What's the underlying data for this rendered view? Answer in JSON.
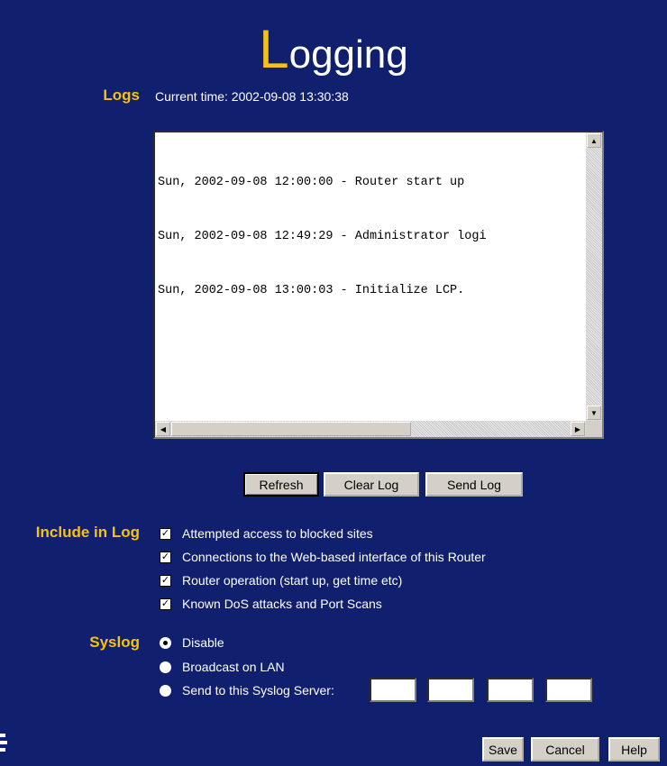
{
  "page": {
    "title_first": "L",
    "title_rest": "ogging"
  },
  "logs": {
    "label": "Logs",
    "current_time": "Current time: 2002-09-08 13:30:38",
    "entries": [
      "Sun, 2002-09-08 12:00:00 - Router start up",
      "Sun, 2002-09-08 12:49:29 - Administrator logi",
      "Sun, 2002-09-08 13:00:03 - Initialize LCP."
    ],
    "buttons": {
      "refresh": "Refresh",
      "clear": "Clear Log",
      "send": "Send Log"
    }
  },
  "include": {
    "label": "Include in Log",
    "options": [
      {
        "label": "Attempted access to blocked sites",
        "checked": true
      },
      {
        "label": "Connections to the Web-based interface of this Router",
        "checked": true
      },
      {
        "label": "Router operation (start up, get time etc)",
        "checked": true
      },
      {
        "label": "Known DoS attacks and Port Scans",
        "checked": true
      }
    ]
  },
  "syslog": {
    "label": "Syslog",
    "options": [
      {
        "label": "Disable",
        "selected": true
      },
      {
        "label": "Broadcast on LAN",
        "selected": false
      },
      {
        "label": "Send to this Syslog Server:",
        "selected": false
      }
    ],
    "ip": [
      "",
      "",
      "",
      ""
    ]
  },
  "footer": {
    "save": "Save",
    "cancel": "Cancel",
    "help": "Help"
  },
  "colors": {
    "background": "#11206e",
    "accent": "#f6c116"
  }
}
